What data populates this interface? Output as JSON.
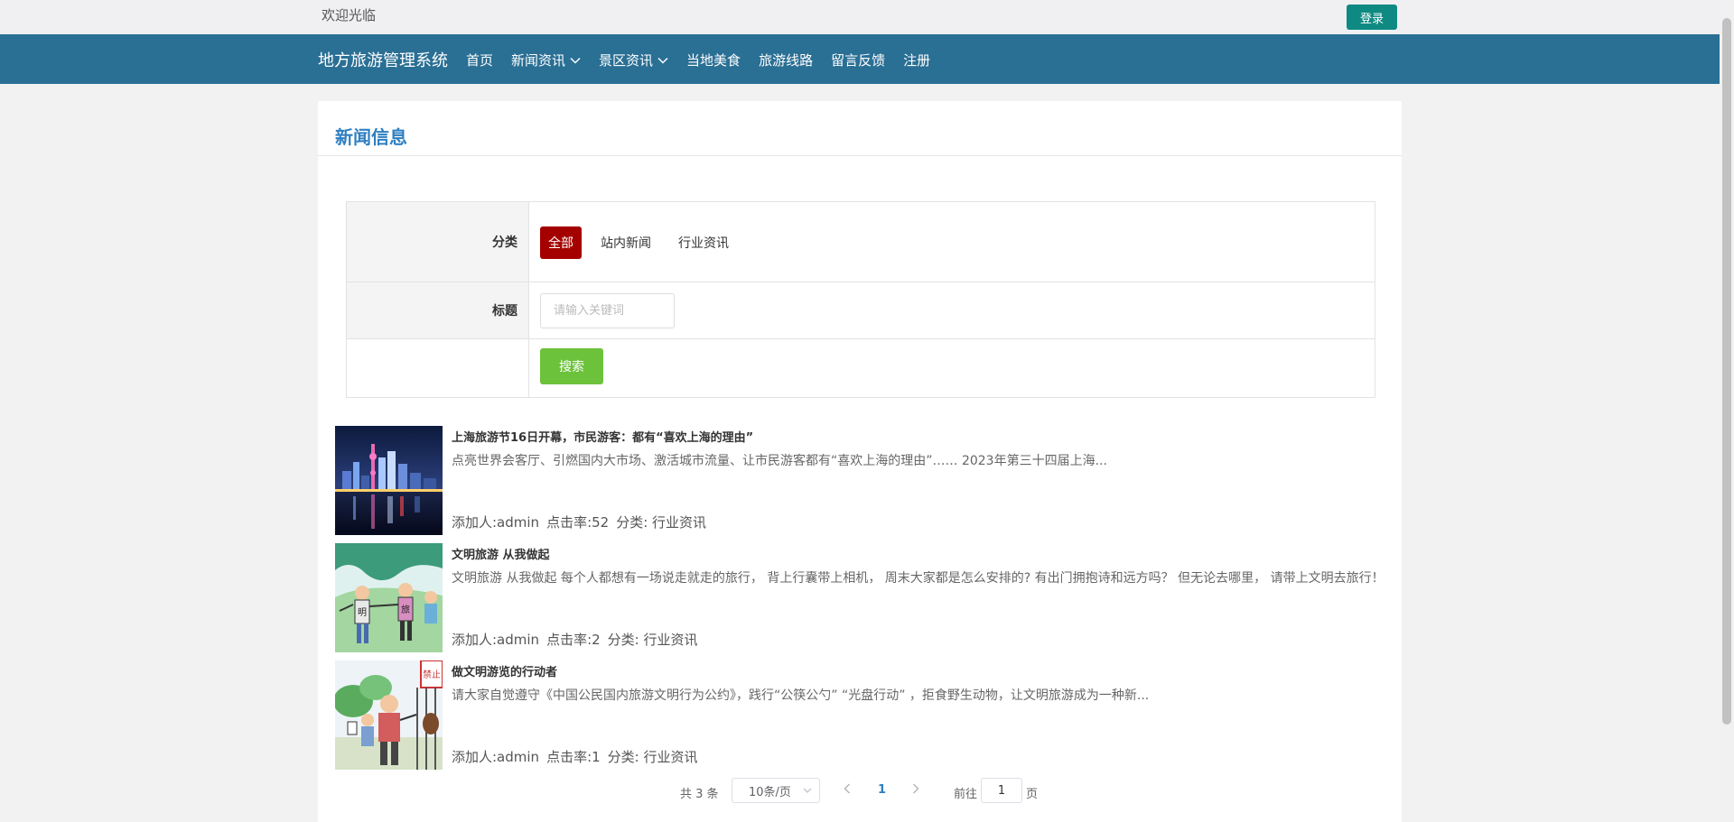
{
  "topbar": {
    "welcome": "欢迎光临",
    "login_label": "登录"
  },
  "navbar": {
    "brand": "地方旅游管理系统",
    "items": [
      {
        "label": "首页",
        "dropdown": false
      },
      {
        "label": "新闻资讯",
        "dropdown": true
      },
      {
        "label": "景区资讯",
        "dropdown": true
      },
      {
        "label": "当地美食",
        "dropdown": false
      },
      {
        "label": "旅游线路",
        "dropdown": false
      },
      {
        "label": "留言反馈",
        "dropdown": false
      },
      {
        "label": "注册",
        "dropdown": false
      }
    ]
  },
  "panel": {
    "title": "新闻信息"
  },
  "filter": {
    "category_label": "分类",
    "categories": [
      "全部",
      "站内新闻",
      "行业资讯"
    ],
    "active_category": "全部",
    "title_label": "标题",
    "keyword_placeholder": "请输入关键词",
    "keyword_value": "",
    "search_label": "搜索"
  },
  "news": [
    {
      "title": "上海旅游节16日开幕，市民游客：都有“喜欢上海的理由”",
      "summary": "点亮世界会客厅、引燃国内大市场、激活城市流量、让市民游客都有“喜欢上海的理由”…… 2023年第三十四届上海...",
      "author": "添加人:admin",
      "clicks": "点击率:52",
      "category": "分类: 行业资讯",
      "image": "night-skyline-photo"
    },
    {
      "title": "文明旅游 从我做起",
      "summary": "文明旅游 从我做起 每个人都想有一场说走就走的旅行， 背上行囊带上相机， 周末大家都是怎么安排的? 有出门拥抱诗和远方吗？ 但无论去哪里， 请带上文明去旅行！",
      "author": "添加人:admin",
      "clicks": "点击率:2",
      "category": "分类: 行业资讯",
      "image": "cartoon-hikers",
      "image_text": [
        "明",
        "旅"
      ]
    },
    {
      "title": "做文明游览的行动者",
      "summary": "请大家自觉遵守《中国公民国内旅游文明行为公约》，践行“公筷公勺” “光盘行动” ，拒食野生动物，让文明旅游成为一种新...",
      "author": "添加人:admin",
      "clicks": "点击率:1",
      "category": "分类: 行业资讯",
      "image": "cartoon-zoo",
      "image_text": "禁止"
    }
  ],
  "pager": {
    "total": "共 3 条",
    "page_size": "10条/页",
    "current_page": "1",
    "goto_prefix": "前往",
    "goto_value": "1",
    "goto_suffix": "页"
  },
  "colors": {
    "navbar": "#2a6f94",
    "login": "#0f8a82",
    "active_category": "#a40000",
    "search": "#6cc23b",
    "title_accent": "#2f7fc1"
  }
}
